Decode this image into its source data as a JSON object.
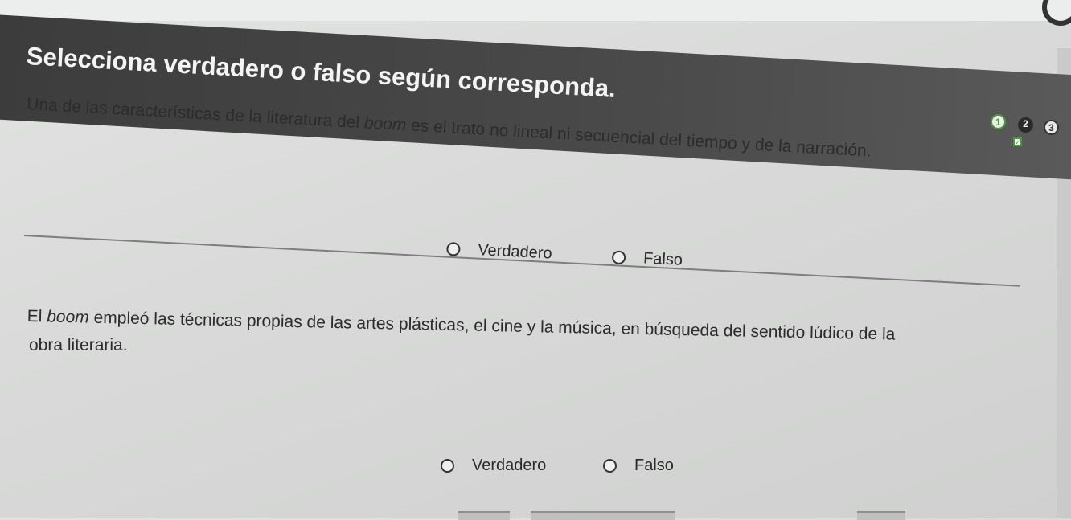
{
  "header": {
    "title": "Selecciona verdadero o falso según corresponda."
  },
  "step_indicators": [
    {
      "label": "1",
      "state": "answered"
    },
    {
      "label": "2",
      "state": "current"
    },
    {
      "label": "3",
      "state": "pending"
    }
  ],
  "questions": [
    {
      "text": "Una de las características de la literatura del boom es el trato no lineal ni secuencial del tiempo y de la narración.",
      "options": {
        "true_label": "Verdadero",
        "false_label": "Falso"
      }
    },
    {
      "text_line1": "El boom empleó las técnicas propias de las artes plásticas, el cine y la música, en búsqueda del sentido lúdico de la",
      "text_line2": "obra literaria.",
      "options": {
        "true_label": "Verdadero",
        "false_label": "Falso"
      }
    }
  ],
  "colors": {
    "header_bg": "#3c3c3c",
    "header_text": "#f4f4f4",
    "answered_green": "#4a9a3a"
  }
}
